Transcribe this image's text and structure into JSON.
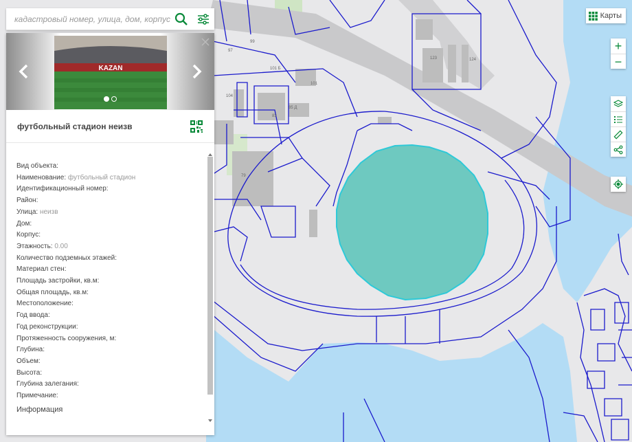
{
  "search": {
    "placeholder": "кадастровый номер, улица, дом, корпус"
  },
  "icons": {
    "search": "search-icon",
    "filter": "sliders-icon",
    "qr": "qr-code-icon",
    "layers_grid": "grid-icon"
  },
  "colors": {
    "accent": "#0a8a3a",
    "parcel_line": "#1a1acc",
    "stadium_fill": "#6ec9c0",
    "water": "#b3dcf5",
    "building": "#bdbdbd"
  },
  "panel": {
    "title": "футбольный стадион неизв",
    "attributes": [
      {
        "label": "Вид объекта:",
        "value": ""
      },
      {
        "label": "Наименование:",
        "value": "футбольный стадион"
      },
      {
        "label": "Идентификационный номер:",
        "value": ""
      },
      {
        "label": "Район:",
        "value": ""
      },
      {
        "label": "Улица:",
        "value": "неизв"
      },
      {
        "label": "Дом:",
        "value": ""
      },
      {
        "label": "Корпус:",
        "value": ""
      },
      {
        "label": "Этажность:",
        "value": "0.00"
      },
      {
        "label": "Количество подземных этажей:",
        "value": ""
      },
      {
        "label": "Материал стен:",
        "value": ""
      },
      {
        "label": "Площадь застройки, кв.м:",
        "value": ""
      },
      {
        "label": "Общая площадь, кв.м:",
        "value": ""
      },
      {
        "label": "Местоположение:",
        "value": ""
      },
      {
        "label": "Год ввода:",
        "value": ""
      },
      {
        "label": "Год реконструкции:",
        "value": ""
      },
      {
        "label": "Протяженность сооружения, м:",
        "value": ""
      },
      {
        "label": "Глубина:",
        "value": ""
      },
      {
        "label": "Объем:",
        "value": ""
      },
      {
        "label": "Высота:",
        "value": ""
      },
      {
        "label": "Глубина залегания:",
        "value": ""
      },
      {
        "label": "Примечание:",
        "value": ""
      }
    ],
    "info_section": "Информация",
    "photo_banner_text": "KAZAN",
    "carousel": {
      "slide_count": 2,
      "active_slide": 1
    }
  },
  "map": {
    "layers_button": "Карты",
    "parcel_labels": [
      "123",
      "124",
      "79",
      "83",
      "85 Д",
      "99",
      "97",
      "101 Б",
      "104",
      "101"
    ]
  }
}
